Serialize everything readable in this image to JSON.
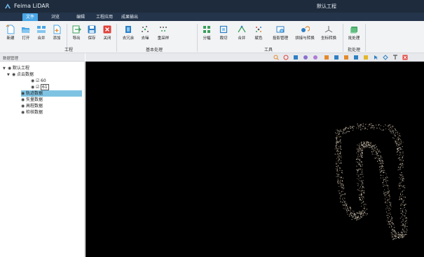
{
  "app": {
    "title": "Feima LiDAR",
    "document_title": "默认工程"
  },
  "menu": {
    "tabs": [
      {
        "label": "文件",
        "active": true
      },
      {
        "label": "浏览",
        "active": false
      },
      {
        "label": "编辑",
        "active": false
      },
      {
        "label": "工程应用",
        "active": false
      },
      {
        "label": "成果输出",
        "active": false
      }
    ]
  },
  "ribbon": {
    "buttons": [
      {
        "id": "new",
        "label": "新建",
        "icon": "new-file-icon"
      },
      {
        "id": "open",
        "label": "打开",
        "icon": "folder-open-icon"
      },
      {
        "id": "merge",
        "label": "合并",
        "icon": "merge-icon"
      },
      {
        "id": "add",
        "label": "添加",
        "icon": "add-file-icon"
      },
      {
        "id": "export",
        "label": "导出",
        "icon": "export-icon"
      },
      {
        "id": "save",
        "label": "保存",
        "icon": "save-icon"
      },
      {
        "id": "close",
        "label": "关闭",
        "icon": "close-icon"
      },
      {
        "id": "deredundant",
        "label": "去冗余",
        "icon": "deredundant-icon"
      },
      {
        "id": "denoise",
        "label": "去噪",
        "icon": "denoise-icon"
      },
      {
        "id": "resample",
        "label": "重采样",
        "icon": "resample-icon"
      },
      {
        "id": "tile",
        "label": "分幅",
        "icon": "tile-icon"
      },
      {
        "id": "crop",
        "label": "裁切",
        "icon": "crop-icon"
      },
      {
        "id": "merge2",
        "label": "合并",
        "icon": "merge-points-icon"
      },
      {
        "id": "colorize",
        "label": "赋色",
        "icon": "colorize-icon"
      },
      {
        "id": "projection",
        "label": "投影管理",
        "icon": "projection-icon"
      },
      {
        "id": "stitch",
        "label": "拼接与转换",
        "icon": "stitch-icon"
      },
      {
        "id": "coord",
        "label": "坐标转换",
        "icon": "coordinate-icon"
      },
      {
        "id": "batch",
        "label": "批处理",
        "icon": "batch-icon"
      }
    ],
    "groups": [
      {
        "label": "工程"
      },
      {
        "label": "基本处理"
      },
      {
        "label": "工具"
      },
      {
        "label": "批处理"
      }
    ]
  },
  "left_panel": {
    "title": "数据管理",
    "tree": [
      {
        "label": "默认工程",
        "level": 0,
        "expander": "▼",
        "eye": true
      },
      {
        "label": "点云数据",
        "level": 1,
        "expander": "▼",
        "eye": true
      },
      {
        "label": "60",
        "level": 2,
        "expander": "",
        "eye": true,
        "check": "☑"
      },
      {
        "label": "61",
        "level": 2,
        "expander": "",
        "eye": true,
        "check": "☑"
      },
      {
        "label": "轨迹数据",
        "level": 1,
        "expander": "",
        "eye": true,
        "selected": true
      },
      {
        "label": "矢量数据",
        "level": 1,
        "expander": "",
        "eye": true
      },
      {
        "label": "高程数据",
        "level": 1,
        "expander": "",
        "eye": true
      },
      {
        "label": "检核数据",
        "level": 1,
        "expander": "",
        "eye": true
      }
    ]
  },
  "view_toolbar": {
    "icons": [
      "zoom-in-icon",
      "rotate-icon",
      "fit-view-icon",
      "view-front-icon",
      "view-side-icon",
      "measure-icon",
      "layer-icon",
      "info-icon",
      "label-icon",
      "color-icon",
      "select-arrow-icon",
      "polygon-icon",
      "pin-icon",
      "close-view-icon"
    ],
    "colors": {
      "accent": "#4aa6e6",
      "orange": "#e3892b",
      "red": "#e0413b",
      "green": "#3aa05a"
    }
  }
}
